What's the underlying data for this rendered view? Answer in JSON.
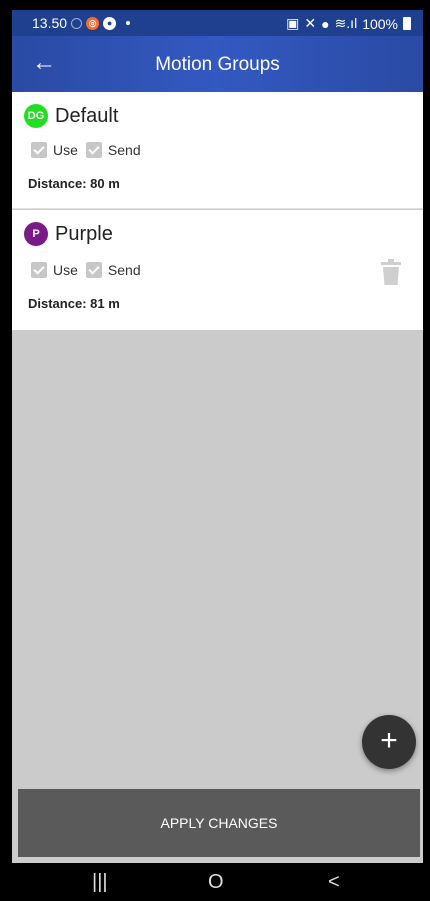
{
  "status_bar": {
    "time": "13.50",
    "battery": "100%"
  },
  "app_bar": {
    "title": "Motion Groups",
    "back_icon": "arrow-left-icon"
  },
  "groups": [
    {
      "initials": "DG",
      "name": "Default",
      "avatar_color": "#22dd22",
      "use_label": "Use",
      "send_label": "Send",
      "use_checked": true,
      "send_checked": true,
      "distance": "Distance: 80 m",
      "deletable": false
    },
    {
      "initials": "P",
      "name": "Purple",
      "avatar_color": "#7a1a86",
      "use_label": "Use",
      "send_label": "Send",
      "use_checked": true,
      "send_checked": true,
      "distance": "Distance: 81 m",
      "deletable": true
    }
  ],
  "fab": {
    "icon": "plus-icon"
  },
  "apply_button": {
    "label": "APPLY CHANGES"
  },
  "nav": {
    "recents": "|||",
    "home": "O",
    "back": "<"
  }
}
